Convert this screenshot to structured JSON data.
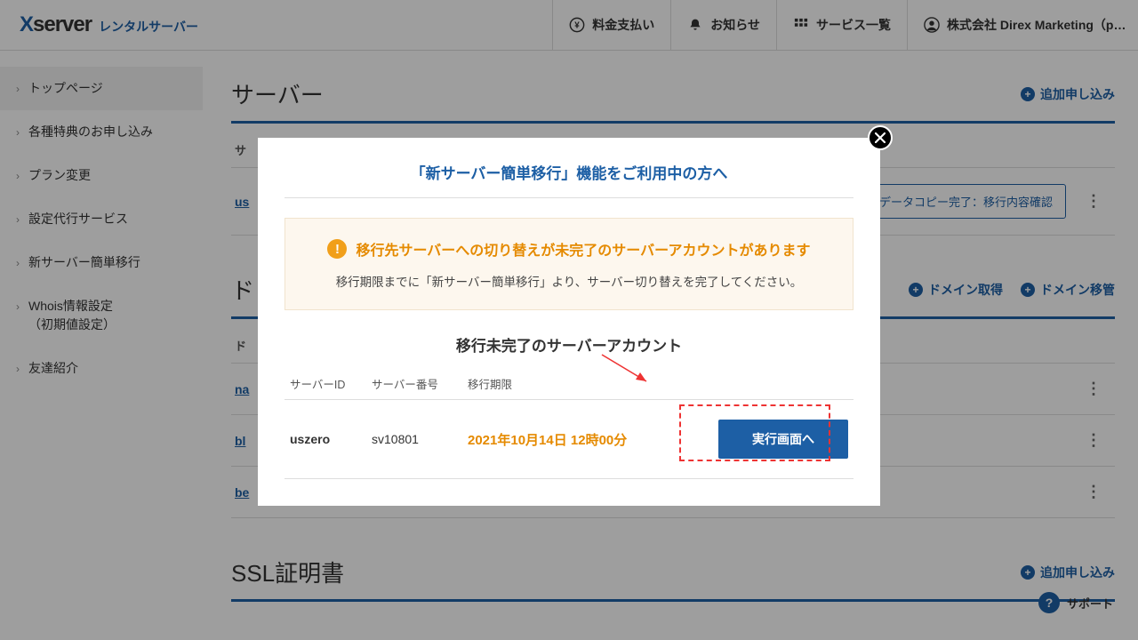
{
  "logo": {
    "brand_x": "X",
    "brand_rest": "server",
    "subtitle": "レンタルサーバー"
  },
  "header_nav": {
    "payment": "料金支払い",
    "notice": "お知らせ",
    "services": "サービス一覧",
    "account": "株式会社 Direx Marketing（p…"
  },
  "sidebar": {
    "items": [
      "トップページ",
      "各種特典のお申し込み",
      "プラン変更",
      "設定代行サービス",
      "新サーバー簡単移行",
      "Whois情報設定",
      "（初期値設定）",
      "友達紹介"
    ]
  },
  "sections": {
    "server": {
      "title": "サーバー",
      "action": "追加申し込み",
      "th0": "サ",
      "row_link": "us",
      "row_button": "データコピー完了：移行内容確認"
    },
    "domain": {
      "title": "ド",
      "action1": "ドメイン取得",
      "action2": "ドメイン移管",
      "th0": "ド",
      "rows": [
        "na",
        "bl",
        "be"
      ]
    },
    "ssl": {
      "title": "SSL証明書",
      "action": "追加申し込み"
    }
  },
  "modal": {
    "title": "「新サーバー簡単移行」機能をご利用中の方へ",
    "notice_headline": "移行先サーバーへの切り替えが未完了のサーバーアカウントがあります",
    "notice_sub": "移行期限までに「新サーバー簡単移行」より、サーバー切り替えを完了してください。",
    "subtitle": "移行未完了のサーバーアカウント",
    "th_id": "サーバーID",
    "th_num": "サーバー番号",
    "th_deadline": "移行期限",
    "row": {
      "id": "uszero",
      "num": "sv10801",
      "deadline": "2021年10月14日 12時00分",
      "button": "実行画面へ"
    }
  },
  "support_label": "サポート"
}
